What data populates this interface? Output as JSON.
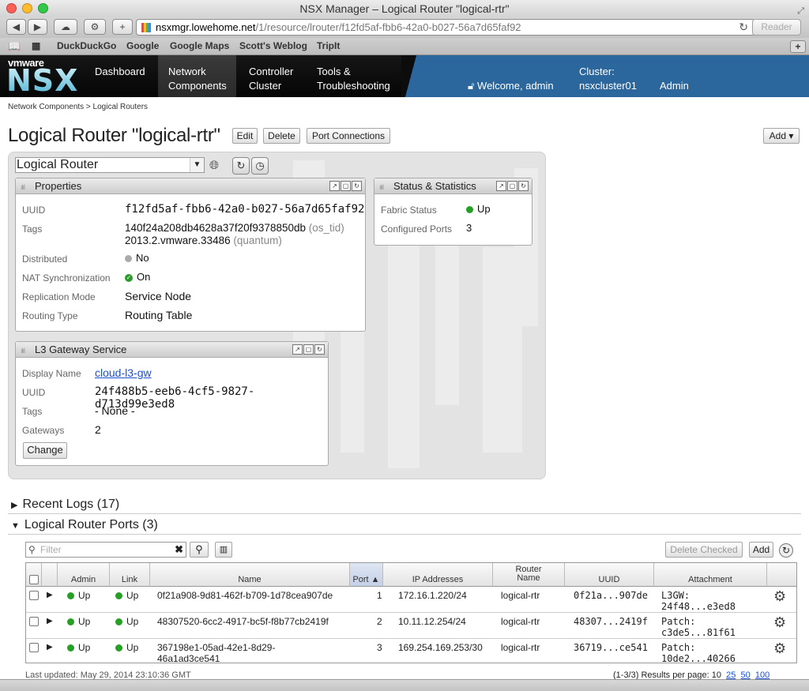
{
  "window": {
    "title": "NSX Manager – Logical Router \"logical-rtr\""
  },
  "browser": {
    "url_host": "nsxmgr.lowehome.net",
    "url_path": "/1/resource/lrouter/f12fd5af-fbb6-42a0-b027-56a7d65faf92",
    "reader_label": "Reader",
    "bookmarks": [
      "DuckDuckGo",
      "Google",
      "Google Maps",
      "Scott's Weblog",
      "TripIt"
    ]
  },
  "nav": {
    "logo_top": "vmware",
    "logo_main": "NSX",
    "items": [
      {
        "line1": "",
        "line2": "Dashboard"
      },
      {
        "line1": "Network",
        "line2": "Components"
      },
      {
        "line1": "Controller",
        "line2": "Cluster"
      },
      {
        "line1": "Tools &",
        "line2": "Troubleshooting"
      }
    ],
    "welcome": "Welcome, admin",
    "cluster_label": "Cluster:",
    "cluster_name": "nsxcluster01",
    "admin": "Admin"
  },
  "breadcrumb": "Network Components > Logical Routers",
  "page": {
    "title": "Logical Router \"logical-rtr\"",
    "edit": "Edit",
    "delete": "Delete",
    "port_connections": "Port Connections",
    "add": "Add"
  },
  "view_select": "Logical Router",
  "properties": {
    "title": "Properties",
    "uuid_label": "UUID",
    "uuid": "f12fd5af-fbb6-42a0-b027-56a7d65faf92",
    "tags_label": "Tags",
    "tag1_value": "140f24a208db4628a37f20f9378850db",
    "tag1_scope": "(os_tid)",
    "tag2_value": "2013.2.vmware.33486",
    "tag2_scope": "(quantum)",
    "distributed_label": "Distributed",
    "distributed": "No",
    "nat_label": "NAT Synchronization",
    "nat": "On",
    "replication_label": "Replication Mode",
    "replication": "Service Node",
    "routing_label": "Routing Type",
    "routing": "Routing Table"
  },
  "status": {
    "title": "Status & Statistics",
    "fabric_label": "Fabric Status",
    "fabric": "Up",
    "ports_label": "Configured Ports",
    "ports": "3"
  },
  "l3": {
    "title": "L3 Gateway Service",
    "display_label": "Display Name",
    "display": "cloud-l3-gw",
    "uuid_label": "UUID",
    "uuid": "24f488b5-eeb6-4cf5-9827-d713d99e3ed8",
    "tags_label": "Tags",
    "tags": "- None -",
    "gateways_label": "Gateways",
    "gateways": "2",
    "change": "Change"
  },
  "recent_logs": "Recent Logs (17)",
  "ports_section": "Logical Router Ports (3)",
  "filter_placeholder": "Filter",
  "delete_checked": "Delete Checked",
  "ports_add": "Add",
  "table": {
    "headers": {
      "admin": "Admin",
      "link": "Link",
      "name": "Name",
      "port": "Port ▲",
      "ip": "IP Addresses",
      "router1": "Router",
      "router2": "Name",
      "uuid": "UUID",
      "attachment": "Attachment"
    },
    "rows": [
      {
        "admin": "Up",
        "link": "Up",
        "name": "0f21a908-9d81-462f-b709-1d78cea907de",
        "name2": "",
        "port": "1",
        "ip": "172.16.1.220/24",
        "router": "logical-rtr",
        "uuid": "0f21a...907de",
        "att1": "L3GW:",
        "att2": "24f48...e3ed8"
      },
      {
        "admin": "Up",
        "link": "Up",
        "name": "48307520-6cc2-4917-bc5f-f8b77cb2419f",
        "name2": "",
        "port": "2",
        "ip": "10.11.12.254/24",
        "router": "logical-rtr",
        "uuid": "48307...2419f",
        "att1": "Patch:",
        "att2": "c3de5...81f61"
      },
      {
        "admin": "Up",
        "link": "Up",
        "name": "367198e1-05ad-42e1-8d29-",
        "name2": "46a1ad3ce541",
        "port": "3",
        "ip": "169.254.169.253/30",
        "router": "logical-rtr",
        "uuid": "36719...ce541",
        "att1": "Patch:",
        "att2": "10de2...40266"
      }
    ]
  },
  "last_updated": "Last updated: May 29, 2014 23:10:36 GMT",
  "results": "(1-3/3)  Results per page:",
  "page_sizes": [
    "10",
    "25",
    "50",
    "100"
  ]
}
